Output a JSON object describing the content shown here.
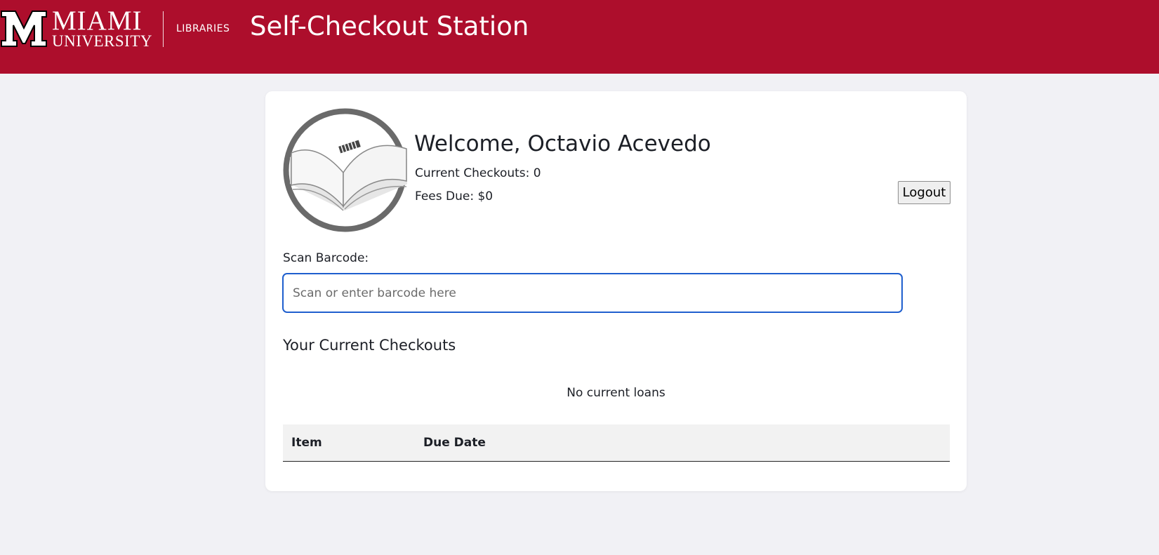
{
  "header": {
    "logo_text_line1": "MIAMI",
    "logo_text_line2": "UNIVERSITY",
    "libraries_label": "LIBRARIES",
    "title": "Self-Checkout Station",
    "brand_color": "#ad0e2c"
  },
  "patron": {
    "welcome": "Welcome, Octavio Acevedo",
    "current_checkouts": "Current Checkouts: 0",
    "fees_due": "Fees Due: $0",
    "avatar_icon": "open-book-icon"
  },
  "actions": {
    "logout_label": "Logout"
  },
  "scan": {
    "label": "Scan Barcode:",
    "placeholder": "Scan or enter barcode here",
    "value": ""
  },
  "checkouts": {
    "section_title": "Your Current Checkouts",
    "empty_message": "No current loans",
    "columns": [
      "Item",
      "Due Date"
    ],
    "rows": []
  }
}
